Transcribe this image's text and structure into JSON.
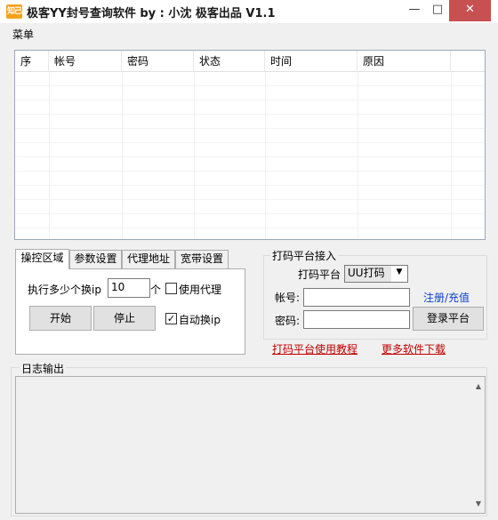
{
  "window": {
    "title": "极客YY封号查询软件     by : 小沈 极客出品 V1.1",
    "icon_text": "知己",
    "minimize": "—",
    "maximize": "□",
    "close": "✕"
  },
  "menu": {
    "item": "菜单"
  },
  "grid": {
    "columns": [
      "序",
      "帐号",
      "密码",
      "状态",
      "时间",
      "原因"
    ],
    "rows": []
  },
  "tabs": {
    "items": [
      "操控区域",
      "参数设置",
      "代理地址",
      "宽带设置"
    ],
    "active": "操控区域"
  },
  "control": {
    "per_ip_label": "执行多少个换ip",
    "per_ip_value": "10",
    "unit_label": "个",
    "use_proxy_label": "使用代理",
    "use_proxy_checked": false,
    "start_button": "开始",
    "stop_button": "停止",
    "auto_ip_label": "自动换ip",
    "auto_ip_checked": true
  },
  "captcha": {
    "group_title": "打码平台接入",
    "platform_label": "打码平台",
    "platform_value": "UU打码",
    "account_label": "帐号:",
    "account_value": "",
    "password_label": "密码:",
    "password_value": "",
    "register_link": "注册/充值",
    "login_button": "登录平台"
  },
  "links": {
    "tutorial": "打码平台使用教程",
    "more_software": "更多软件下载"
  },
  "log": {
    "title": "日志输出",
    "content": ""
  }
}
